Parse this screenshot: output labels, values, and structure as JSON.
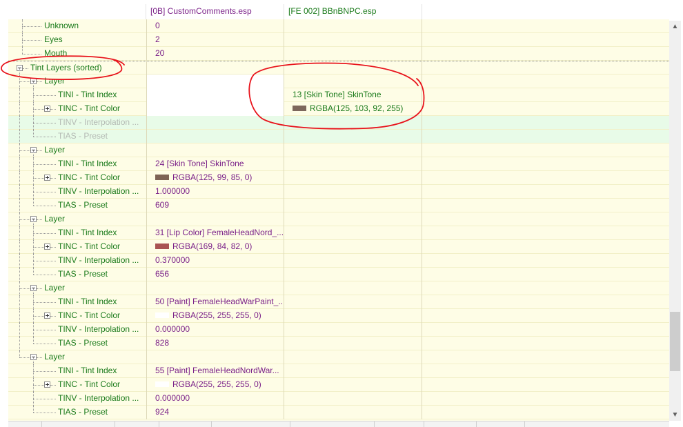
{
  "header": {
    "col0": "",
    "col1": "[0B] CustomComments.esp",
    "col2": "[FE 002] BBnBNPC.esp"
  },
  "rows": [
    {
      "label": "Unknown",
      "v1": "0",
      "v2": ""
    },
    {
      "label": "Eyes",
      "v1": "2",
      "v2": ""
    },
    {
      "label": "Mouth",
      "v1": "20",
      "v2": ""
    },
    {
      "label": "Tint Layers (sorted)",
      "v1": "",
      "v2": ""
    },
    {
      "label": "Layer",
      "v1": "",
      "v2": ""
    },
    {
      "label": "TINI - Tint Index",
      "v1": "",
      "v2": "13 [Skin Tone] SkinTone"
    },
    {
      "label": "TINC - Tint Color",
      "v1": "",
      "v2": "RGBA(125, 103, 92, 255)"
    },
    {
      "label": "TINV - Interpolation ...",
      "v1": "",
      "v2": ""
    },
    {
      "label": "TIAS - Preset",
      "v1": "",
      "v2": ""
    },
    {
      "label": "Layer",
      "v1": "",
      "v2": ""
    },
    {
      "label": "TINI - Tint Index",
      "v1": "24 [Skin Tone] SkinTone",
      "v2": ""
    },
    {
      "label": "TINC - Tint Color",
      "v1": "RGBA(125, 99, 85, 0)",
      "v2": ""
    },
    {
      "label": "TINV - Interpolation ...",
      "v1": "1.000000",
      "v2": ""
    },
    {
      "label": "TIAS - Preset",
      "v1": "609",
      "v2": ""
    },
    {
      "label": "Layer",
      "v1": "",
      "v2": ""
    },
    {
      "label": "TINI - Tint Index",
      "v1": "31 [Lip Color] FemaleHeadNord_...",
      "v2": ""
    },
    {
      "label": "TINC - Tint Color",
      "v1": "RGBA(169, 84, 82, 0)",
      "v2": ""
    },
    {
      "label": "TINV - Interpolation ...",
      "v1": "0.370000",
      "v2": ""
    },
    {
      "label": "TIAS - Preset",
      "v1": "656",
      "v2": ""
    },
    {
      "label": "Layer",
      "v1": "",
      "v2": ""
    },
    {
      "label": "TINI - Tint Index",
      "v1": "50 [Paint] FemaleHeadWarPaint_...",
      "v2": ""
    },
    {
      "label": "TINC - Tint Color",
      "v1": "RGBA(255, 255, 255, 0)",
      "v2": ""
    },
    {
      "label": "TINV - Interpolation ...",
      "v1": "0.000000",
      "v2": ""
    },
    {
      "label": "TIAS - Preset",
      "v1": "828",
      "v2": ""
    },
    {
      "label": "Layer",
      "v1": "",
      "v2": ""
    },
    {
      "label": "TINI - Tint Index",
      "v1": "55 [Paint] FemaleHeadNordWar...",
      "v2": ""
    },
    {
      "label": "TINC - Tint Color",
      "v1": "RGBA(255, 255, 255, 0)",
      "v2": ""
    },
    {
      "label": "TINV - Interpolation ...",
      "v1": "0.000000",
      "v2": ""
    },
    {
      "label": "TIAS - Preset",
      "v1": "924",
      "v2": ""
    }
  ],
  "swatches": {
    "v2_6": "#7d675c",
    "v1_11": "#7d6355",
    "v1_16": "#a95452",
    "v1_21": "#ffffff",
    "v1_26": "#ffffff"
  },
  "colors": {
    "row_background": "#fefde6",
    "disabled_row_background": "#e8fbe8",
    "field_label_green": "#1a7a1a",
    "value_purple": "#7a2088",
    "annotation_red": "#e8141c"
  },
  "scrollbar": {
    "position_fraction": 0.88
  },
  "icons": {
    "expand": "plus-box-icon",
    "collapse": "minus-box-icon",
    "scroll_up": "chevron-up-icon",
    "scroll_down": "chevron-down-icon"
  }
}
